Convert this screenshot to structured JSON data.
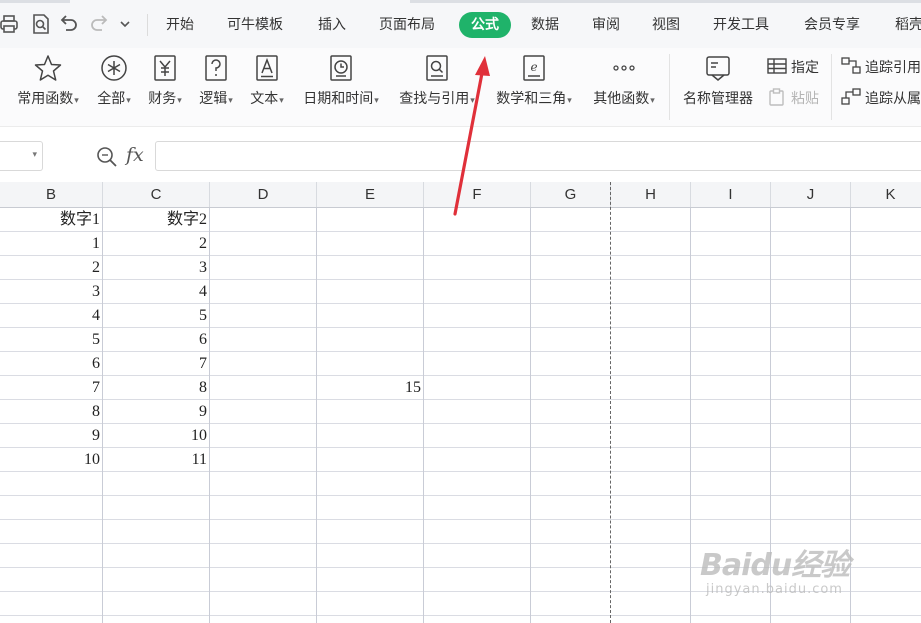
{
  "tabs": [
    {
      "label": "开始"
    },
    {
      "label": "可牛模板"
    },
    {
      "label": "插入"
    },
    {
      "label": "页面布局"
    },
    {
      "label": "公式",
      "active": true
    },
    {
      "label": "数据"
    },
    {
      "label": "审阅"
    },
    {
      "label": "视图"
    },
    {
      "label": "开发工具"
    },
    {
      "label": "会员专享"
    },
    {
      "label": "稻壳"
    }
  ],
  "ribbon": {
    "functions": [
      {
        "label": "常用函数",
        "icon": "star-icon"
      },
      {
        "label": "全部",
        "icon": "asterisk-circle-icon"
      },
      {
        "label": "财务",
        "icon": "yen-document-icon"
      },
      {
        "label": "逻辑",
        "icon": "question-document-icon"
      },
      {
        "label": "文本",
        "icon": "text-a-icon"
      },
      {
        "label": "日期和时间",
        "icon": "clock-document-icon"
      },
      {
        "label": "查找与引用",
        "icon": "search-document-icon"
      },
      {
        "label": "数学和三角",
        "icon": "math-e-icon"
      },
      {
        "label": "其他函数",
        "icon": "more-dots-icon"
      }
    ],
    "name_manager": "名称管理器",
    "specify": "指定",
    "paste": "粘贴",
    "trace_precedents": "追踪引用",
    "trace_dependents": "追踪从属"
  },
  "formula_bar": {
    "fx_label": "fx",
    "value": ""
  },
  "columns": [
    "B",
    "C",
    "D",
    "E",
    "F",
    "G",
    "H",
    "I",
    "J",
    "K"
  ],
  "cells": {
    "B": [
      "数字1",
      "1",
      "2",
      "3",
      "4",
      "5",
      "6",
      "7",
      "8",
      "9",
      "10"
    ],
    "C": [
      "数字2",
      "2",
      "3",
      "4",
      "5",
      "6",
      "7",
      "8",
      "9",
      "10",
      "11"
    ],
    "E7": "15"
  },
  "watermark": {
    "brand": "Baidu经验",
    "url": "jingyan.baidu.com"
  },
  "colors": {
    "accent": "#1fb36a",
    "arrow": "#e0303a"
  }
}
